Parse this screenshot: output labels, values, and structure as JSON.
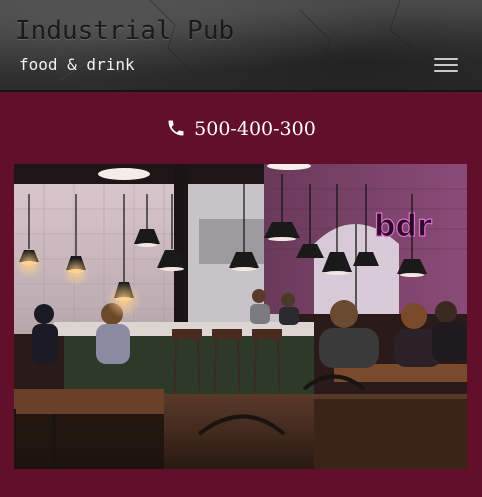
{
  "header": {
    "title": "Industrial Pub",
    "tagline": "food & drink",
    "menu_icon": "hamburger-menu-icon"
  },
  "contact": {
    "phone_icon": "phone-icon",
    "phone": "500-400-300"
  },
  "hero": {
    "sign_text": "bdr"
  },
  "colors": {
    "page_background": "#620f2c",
    "header_background": "#3a3a3a",
    "text_light": "#ffffff",
    "sign_pink": "#e06ad7"
  }
}
